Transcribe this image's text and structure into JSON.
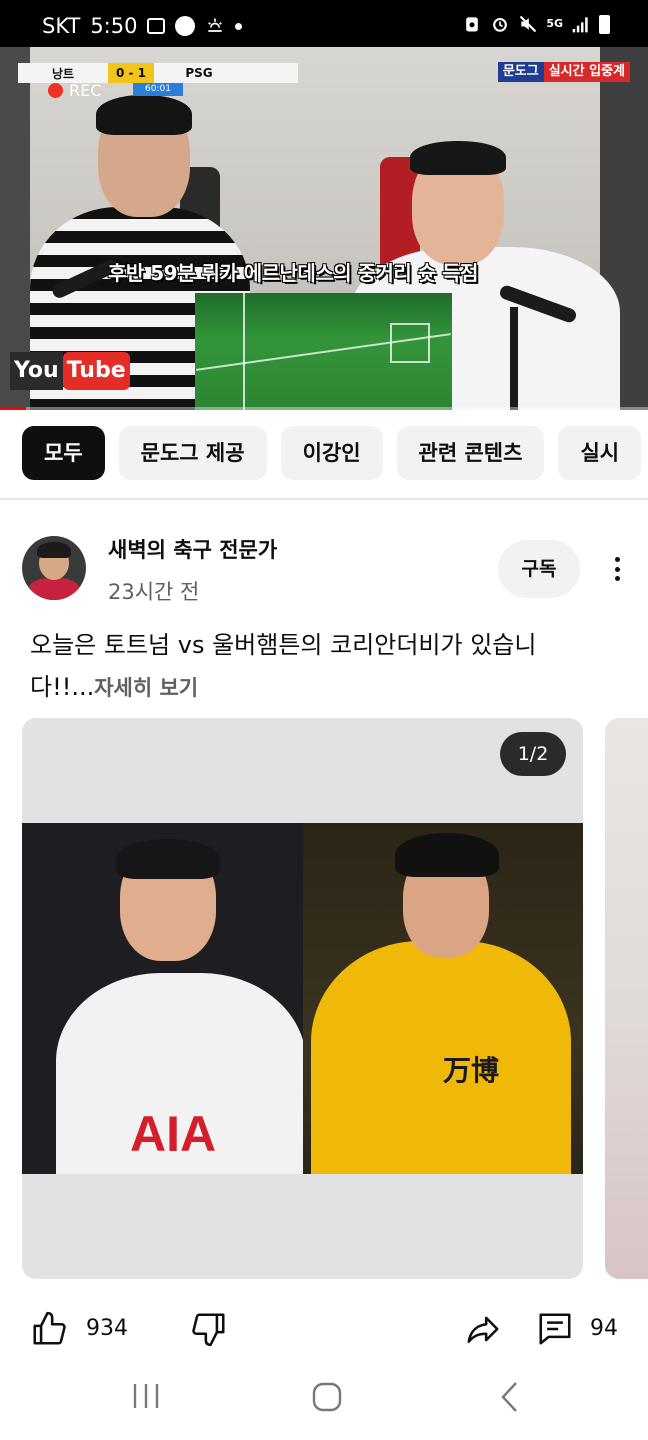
{
  "status_bar": {
    "carrier": "SKT",
    "time": "5:50",
    "network": "5G"
  },
  "video": {
    "score_home": "낭트",
    "score": "0 - 1",
    "score_away": "PSG",
    "match_clock": "60:01",
    "rec_label": "REC",
    "live_brand": "문도그",
    "live_label": "실시간 입중계",
    "caption": "후반 59분 뤼카 에르난데스의 중거리 슛 득점",
    "yt_you": "You",
    "yt_tube": "Tube",
    "progress_percent": 4
  },
  "chips": [
    {
      "label": "모두",
      "active": true
    },
    {
      "label": "문도그 제공",
      "active": false
    },
    {
      "label": "이강인",
      "active": false
    },
    {
      "label": "관련 콘텐츠",
      "active": false
    },
    {
      "label": "실시",
      "active": false
    }
  ],
  "post": {
    "channel_name": "새벽의 축구 전문가",
    "time_ago": "23시간 전",
    "subscribe_label": "구독",
    "text": "오늘은 토트넘 vs 울버햄튼의 코리안더비가 있습니다!!...",
    "more_label": "자세히 보기",
    "page_indicator": "1/2",
    "image_left_sponsor": "AIA",
    "image_right_sponsor": "万博"
  },
  "actions": {
    "likes": "934",
    "comments": "94"
  }
}
